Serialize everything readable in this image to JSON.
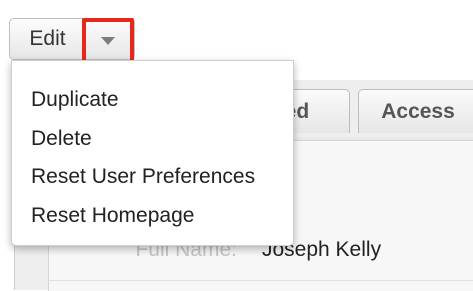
{
  "toolbar": {
    "edit_label": "Edit",
    "caret_icon": "caret-down-icon",
    "highlight_color": "#e8271c"
  },
  "menu": {
    "items": [
      {
        "label": "Duplicate"
      },
      {
        "label": "Delete"
      },
      {
        "label": "Reset User Preferences"
      },
      {
        "label": "Reset Homepage"
      }
    ]
  },
  "tabs": [
    {
      "label": "ced"
    },
    {
      "label": "Access"
    }
  ],
  "form": {
    "full_name_label": "Full Name:",
    "full_name_value": "Joseph Kelly"
  }
}
